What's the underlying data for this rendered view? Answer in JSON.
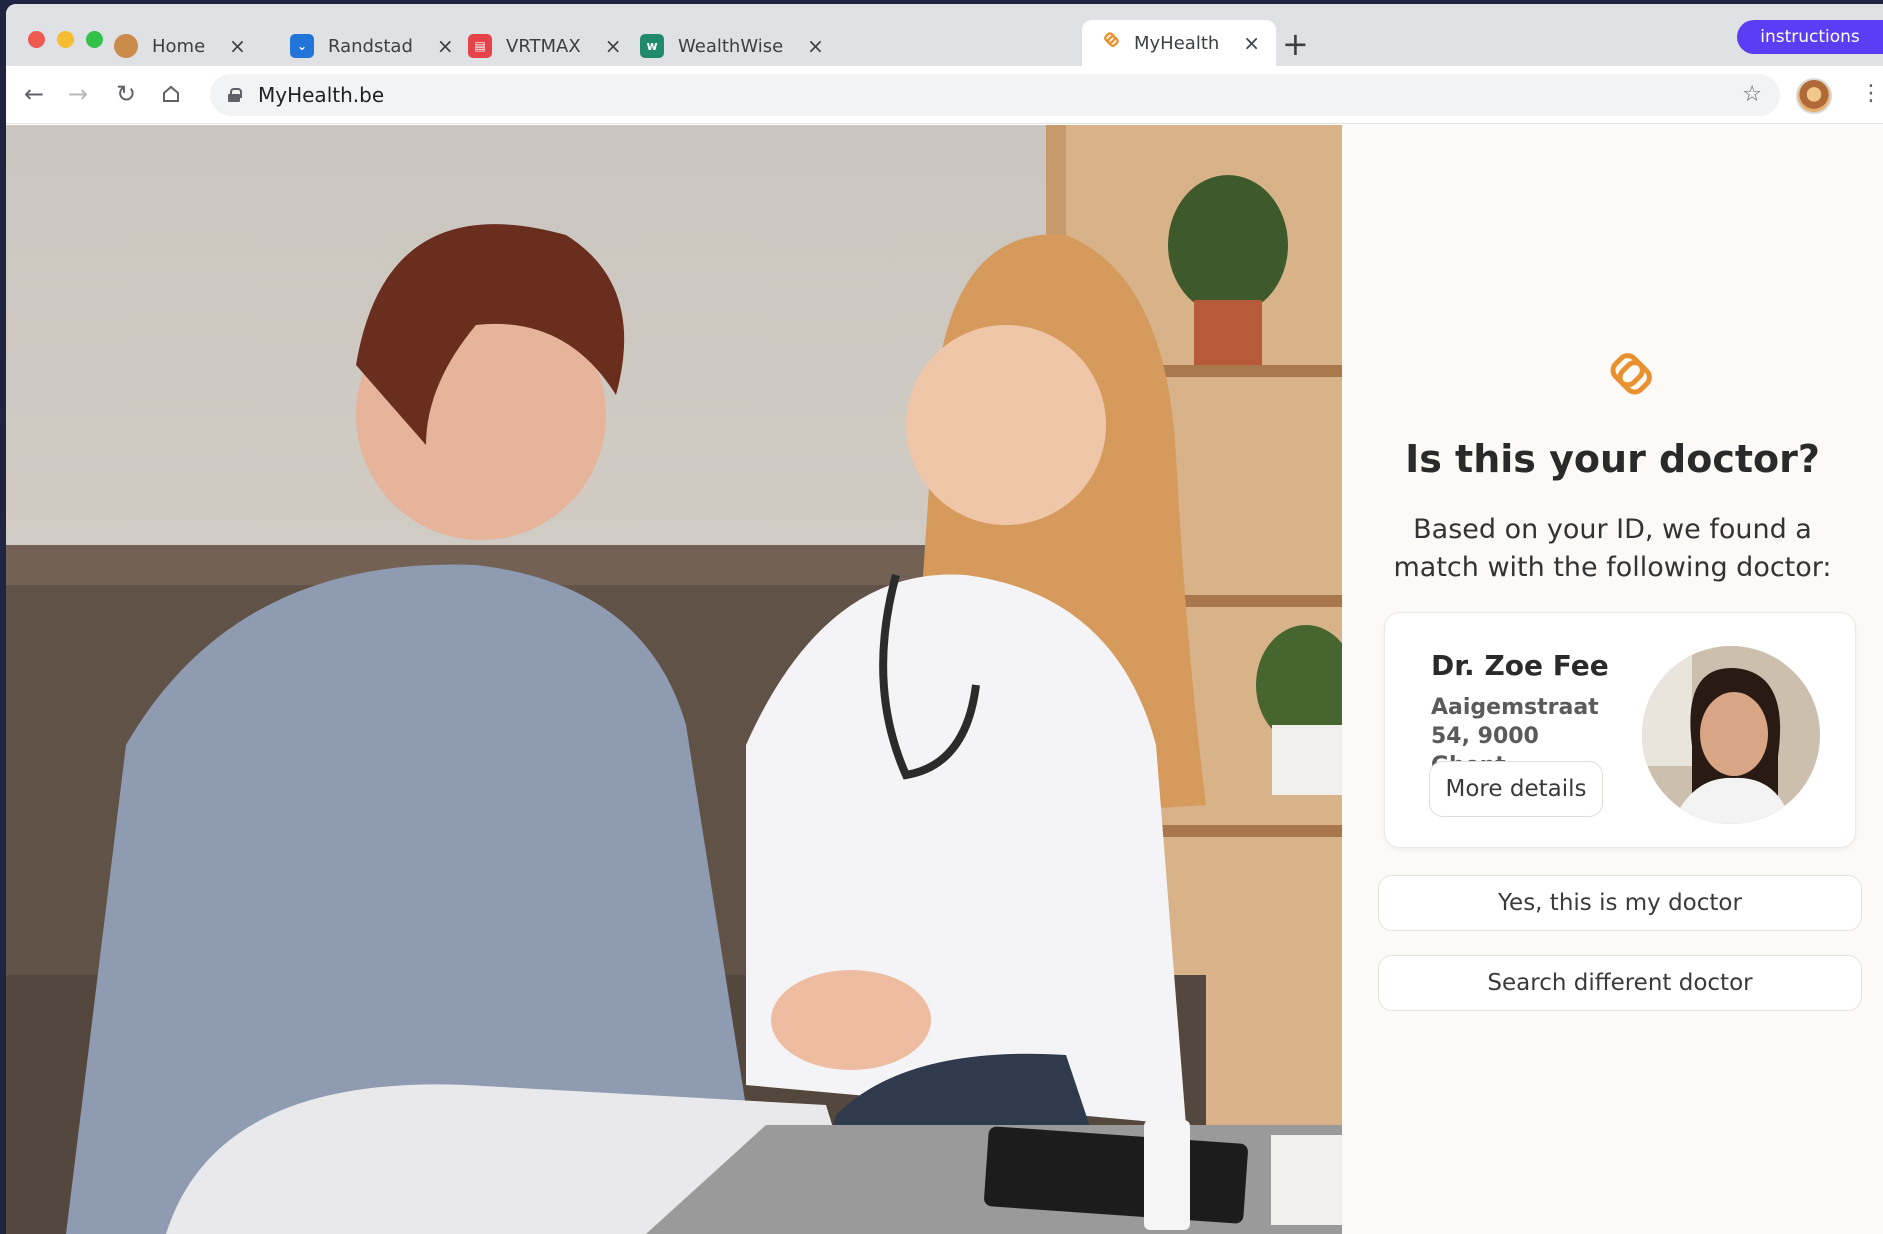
{
  "browser": {
    "tabs": [
      {
        "label": "Home",
        "favicon": "dog-avatar-icon"
      },
      {
        "label": "Randstad",
        "favicon": "randstad-icon"
      },
      {
        "label": "VRTMAX",
        "favicon": "vrtmax-icon"
      },
      {
        "label": "WealthWise",
        "favicon": "wealthwise-icon"
      },
      {
        "label": "MyHealth",
        "favicon": "myhealth-icon",
        "active": true
      }
    ],
    "close_glyph": "×",
    "new_tab_glyph": "+",
    "instructions_label": "instructions",
    "url": "MyHealth.be",
    "colors": {
      "tab_strip": "#dfe1e5",
      "instructions": "#5b3df5"
    }
  },
  "panel": {
    "heading": "Is this your doctor?",
    "subtext": "Based on your ID, we found a match with the following doctor:",
    "doctor": {
      "name": "Dr. Zoe Fee",
      "address": "Aaigemstraat 54, 9000 Ghent",
      "more_details_label": "More details"
    },
    "confirm_label": "Yes, this is my doctor",
    "search_label": "Search different doctor",
    "colors": {
      "brand": "#e8912e",
      "background": "#fcfaf6"
    }
  }
}
